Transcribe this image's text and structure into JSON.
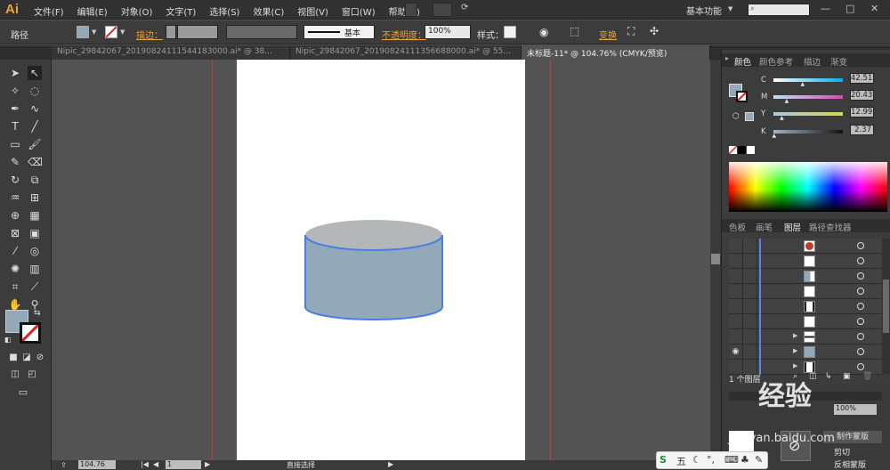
{
  "app": {
    "logo": "Ai"
  },
  "menu": [
    "文件(F)",
    "编辑(E)",
    "对象(O)",
    "文字(T)",
    "选择(S)",
    "效果(C)",
    "视图(V)",
    "窗口(W)",
    "帮助(H)"
  ],
  "workspace_label": "基本功能",
  "control_bar": {
    "mode_label": "路径",
    "stroke_label": "描边：",
    "stroke_style": "基本",
    "opacity_label": "不透明度：",
    "opacity_value": "100%",
    "style_label": "样式：",
    "transform_label": "变换"
  },
  "tabs": [
    {
      "label": "Nipic_29842067_20190824111544183000.ai* @ 38...",
      "active": false
    },
    {
      "label": "Nipic_29842067_20190824111356688000.ai* @ 55...",
      "active": false
    },
    {
      "label": "未标题-11* @ 104.76% (CMYK/预览)",
      "active": true
    }
  ],
  "color_panel": {
    "tabs": [
      "颜色",
      "颜色参考",
      "描边",
      "渐变"
    ],
    "channels": [
      {
        "label": "C",
        "value": "42.51",
        "fraction": 0.43
      },
      {
        "label": "M",
        "value": "20.43",
        "fraction": 0.2
      },
      {
        "label": "Y",
        "value": "12.99",
        "fraction": 0.13
      },
      {
        "label": "K",
        "value": "2.37",
        "fraction": 0.02
      }
    ],
    "fill_color": "#93a8b8"
  },
  "layers_panel": {
    "tabs": [
      "色板",
      "画笔",
      "图层",
      "路径查找器"
    ],
    "rows": 9,
    "footer_label": "1 个图层"
  },
  "status_bar": {
    "zoom": "104.76",
    "page": "1",
    "tool": "直接选择"
  },
  "lower_panel": {
    "make_mask": "制作蒙版",
    "clip": "剪切",
    "invert_mask": "反相蒙版",
    "opacity_value": "100%"
  },
  "watermark": {
    "text": "经验",
    "url": "jingyan.baidu.com"
  },
  "taskbar": {
    "ime": "五"
  },
  "cylinder": {
    "top_color": "#b4b7b8",
    "body_color": "#93a8b8",
    "outline_color": "#4a7de8"
  }
}
